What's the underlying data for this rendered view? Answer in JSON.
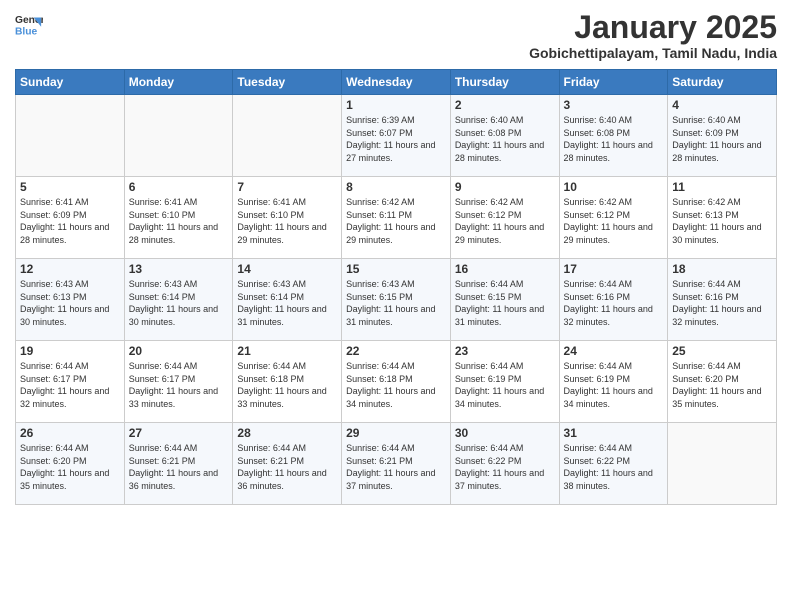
{
  "logo": {
    "line1": "General",
    "line2": "Blue"
  },
  "title": "January 2025",
  "subtitle": "Gobichettipalayam, Tamil Nadu, India",
  "weekdays": [
    "Sunday",
    "Monday",
    "Tuesday",
    "Wednesday",
    "Thursday",
    "Friday",
    "Saturday"
  ],
  "weeks": [
    [
      {
        "day": "",
        "sunrise": "",
        "sunset": "",
        "daylight": ""
      },
      {
        "day": "",
        "sunrise": "",
        "sunset": "",
        "daylight": ""
      },
      {
        "day": "",
        "sunrise": "",
        "sunset": "",
        "daylight": ""
      },
      {
        "day": "1",
        "sunrise": "Sunrise: 6:39 AM",
        "sunset": "Sunset: 6:07 PM",
        "daylight": "Daylight: 11 hours and 27 minutes."
      },
      {
        "day": "2",
        "sunrise": "Sunrise: 6:40 AM",
        "sunset": "Sunset: 6:08 PM",
        "daylight": "Daylight: 11 hours and 28 minutes."
      },
      {
        "day": "3",
        "sunrise": "Sunrise: 6:40 AM",
        "sunset": "Sunset: 6:08 PM",
        "daylight": "Daylight: 11 hours and 28 minutes."
      },
      {
        "day": "4",
        "sunrise": "Sunrise: 6:40 AM",
        "sunset": "Sunset: 6:09 PM",
        "daylight": "Daylight: 11 hours and 28 minutes."
      }
    ],
    [
      {
        "day": "5",
        "sunrise": "Sunrise: 6:41 AM",
        "sunset": "Sunset: 6:09 PM",
        "daylight": "Daylight: 11 hours and 28 minutes."
      },
      {
        "day": "6",
        "sunrise": "Sunrise: 6:41 AM",
        "sunset": "Sunset: 6:10 PM",
        "daylight": "Daylight: 11 hours and 28 minutes."
      },
      {
        "day": "7",
        "sunrise": "Sunrise: 6:41 AM",
        "sunset": "Sunset: 6:10 PM",
        "daylight": "Daylight: 11 hours and 29 minutes."
      },
      {
        "day": "8",
        "sunrise": "Sunrise: 6:42 AM",
        "sunset": "Sunset: 6:11 PM",
        "daylight": "Daylight: 11 hours and 29 minutes."
      },
      {
        "day": "9",
        "sunrise": "Sunrise: 6:42 AM",
        "sunset": "Sunset: 6:12 PM",
        "daylight": "Daylight: 11 hours and 29 minutes."
      },
      {
        "day": "10",
        "sunrise": "Sunrise: 6:42 AM",
        "sunset": "Sunset: 6:12 PM",
        "daylight": "Daylight: 11 hours and 29 minutes."
      },
      {
        "day": "11",
        "sunrise": "Sunrise: 6:42 AM",
        "sunset": "Sunset: 6:13 PM",
        "daylight": "Daylight: 11 hours and 30 minutes."
      }
    ],
    [
      {
        "day": "12",
        "sunrise": "Sunrise: 6:43 AM",
        "sunset": "Sunset: 6:13 PM",
        "daylight": "Daylight: 11 hours and 30 minutes."
      },
      {
        "day": "13",
        "sunrise": "Sunrise: 6:43 AM",
        "sunset": "Sunset: 6:14 PM",
        "daylight": "Daylight: 11 hours and 30 minutes."
      },
      {
        "day": "14",
        "sunrise": "Sunrise: 6:43 AM",
        "sunset": "Sunset: 6:14 PM",
        "daylight": "Daylight: 11 hours and 31 minutes."
      },
      {
        "day": "15",
        "sunrise": "Sunrise: 6:43 AM",
        "sunset": "Sunset: 6:15 PM",
        "daylight": "Daylight: 11 hours and 31 minutes."
      },
      {
        "day": "16",
        "sunrise": "Sunrise: 6:44 AM",
        "sunset": "Sunset: 6:15 PM",
        "daylight": "Daylight: 11 hours and 31 minutes."
      },
      {
        "day": "17",
        "sunrise": "Sunrise: 6:44 AM",
        "sunset": "Sunset: 6:16 PM",
        "daylight": "Daylight: 11 hours and 32 minutes."
      },
      {
        "day": "18",
        "sunrise": "Sunrise: 6:44 AM",
        "sunset": "Sunset: 6:16 PM",
        "daylight": "Daylight: 11 hours and 32 minutes."
      }
    ],
    [
      {
        "day": "19",
        "sunrise": "Sunrise: 6:44 AM",
        "sunset": "Sunset: 6:17 PM",
        "daylight": "Daylight: 11 hours and 32 minutes."
      },
      {
        "day": "20",
        "sunrise": "Sunrise: 6:44 AM",
        "sunset": "Sunset: 6:17 PM",
        "daylight": "Daylight: 11 hours and 33 minutes."
      },
      {
        "day": "21",
        "sunrise": "Sunrise: 6:44 AM",
        "sunset": "Sunset: 6:18 PM",
        "daylight": "Daylight: 11 hours and 33 minutes."
      },
      {
        "day": "22",
        "sunrise": "Sunrise: 6:44 AM",
        "sunset": "Sunset: 6:18 PM",
        "daylight": "Daylight: 11 hours and 34 minutes."
      },
      {
        "day": "23",
        "sunrise": "Sunrise: 6:44 AM",
        "sunset": "Sunset: 6:19 PM",
        "daylight": "Daylight: 11 hours and 34 minutes."
      },
      {
        "day": "24",
        "sunrise": "Sunrise: 6:44 AM",
        "sunset": "Sunset: 6:19 PM",
        "daylight": "Daylight: 11 hours and 34 minutes."
      },
      {
        "day": "25",
        "sunrise": "Sunrise: 6:44 AM",
        "sunset": "Sunset: 6:20 PM",
        "daylight": "Daylight: 11 hours and 35 minutes."
      }
    ],
    [
      {
        "day": "26",
        "sunrise": "Sunrise: 6:44 AM",
        "sunset": "Sunset: 6:20 PM",
        "daylight": "Daylight: 11 hours and 35 minutes."
      },
      {
        "day": "27",
        "sunrise": "Sunrise: 6:44 AM",
        "sunset": "Sunset: 6:21 PM",
        "daylight": "Daylight: 11 hours and 36 minutes."
      },
      {
        "day": "28",
        "sunrise": "Sunrise: 6:44 AM",
        "sunset": "Sunset: 6:21 PM",
        "daylight": "Daylight: 11 hours and 36 minutes."
      },
      {
        "day": "29",
        "sunrise": "Sunrise: 6:44 AM",
        "sunset": "Sunset: 6:21 PM",
        "daylight": "Daylight: 11 hours and 37 minutes."
      },
      {
        "day": "30",
        "sunrise": "Sunrise: 6:44 AM",
        "sunset": "Sunset: 6:22 PM",
        "daylight": "Daylight: 11 hours and 37 minutes."
      },
      {
        "day": "31",
        "sunrise": "Sunrise: 6:44 AM",
        "sunset": "Sunset: 6:22 PM",
        "daylight": "Daylight: 11 hours and 38 minutes."
      },
      {
        "day": "",
        "sunrise": "",
        "sunset": "",
        "daylight": ""
      }
    ]
  ]
}
